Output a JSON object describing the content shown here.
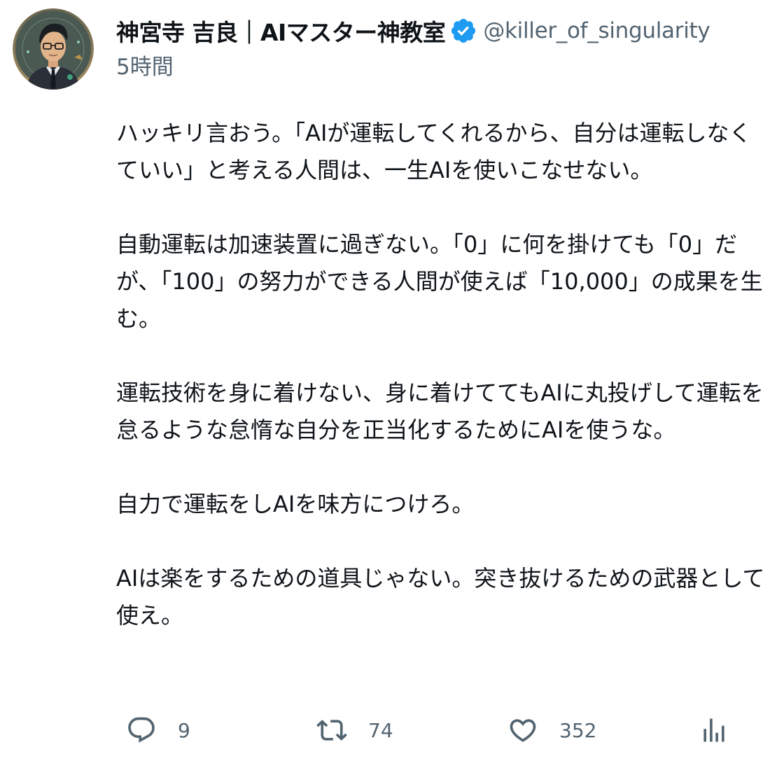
{
  "author": {
    "display_name": "神宮寺 吉良｜AIマスター神教室",
    "handle": "@killer_of_singularity",
    "verified": true,
    "avatar_icon": "avatar-illustrated-man-glasses-suit"
  },
  "timestamp": "5時間",
  "body": {
    "paragraphs": [
      "ハッキリ言おう。「AIが運転してくれるから、自分は運転しなくていい」と考える人間は、一生AIを使いこなせない。",
      "自動運転は加速装置に過ぎない。「0」に何を掛けても「0」だが、「100」の努力ができる人間が使えば「10,000」の成果を生む。",
      "運転技術を身に着けない、身に着けててもAIに丸投げして運転を怠るような怠惰な自分を正当化するためにAIを使うな。",
      "自力で運転をしAIを味方につけろ。",
      "AIは楽をするための道具じゃない。突き抜けるための武器として使え。"
    ]
  },
  "actions": {
    "reply": {
      "icon": "reply-icon",
      "count": "9"
    },
    "retweet": {
      "icon": "retweet-icon",
      "count": "74"
    },
    "like": {
      "icon": "heart-icon",
      "count": "352"
    },
    "views": {
      "icon": "analytics-icon"
    }
  },
  "colors": {
    "text_primary": "#0f1419",
    "text_secondary": "#536471",
    "verified_blue": "#1d9bf0",
    "background": "#ffffff"
  }
}
